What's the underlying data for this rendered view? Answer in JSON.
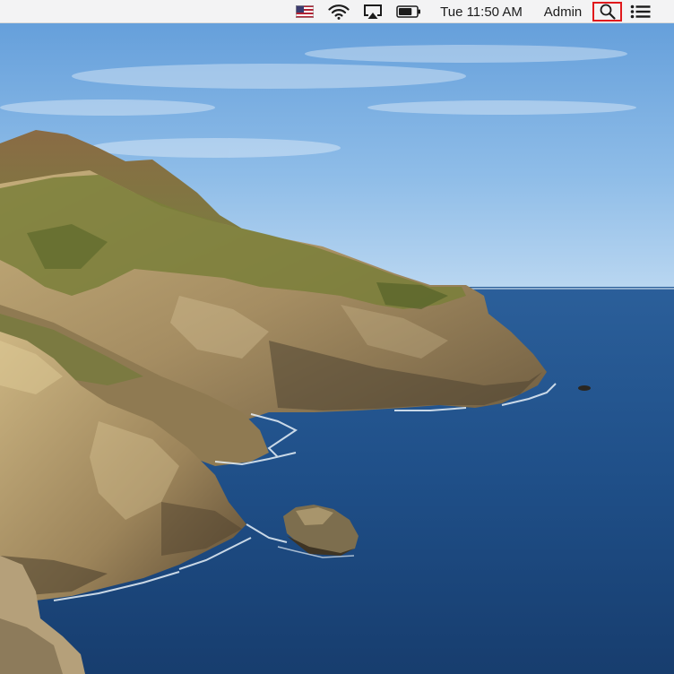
{
  "menubar": {
    "input_source": {
      "icon": "us-flag-icon",
      "colors": [
        "#b22234",
        "#ffffff",
        "#3c3b6e"
      ]
    },
    "wifi": {
      "icon": "wifi-icon"
    },
    "airplay": {
      "icon": "airplay-icon"
    },
    "battery": {
      "icon": "battery-icon",
      "level": 0.75
    },
    "clock": "Tue 11:50 AM",
    "user": "Admin",
    "spotlight": {
      "icon": "magnifier-icon",
      "highlighted": true,
      "highlight_color": "#e0191c"
    },
    "notification_center": {
      "icon": "list-icon"
    }
  },
  "desktop": {
    "wallpaper": "coastal cliffs and ocean",
    "colors": {
      "sky_top": "#5f9bd9",
      "sky_bottom": "#b9d6f0",
      "sea": "#1f4f8a",
      "rock": "#a89466",
      "grass": "#6f7a36"
    }
  }
}
